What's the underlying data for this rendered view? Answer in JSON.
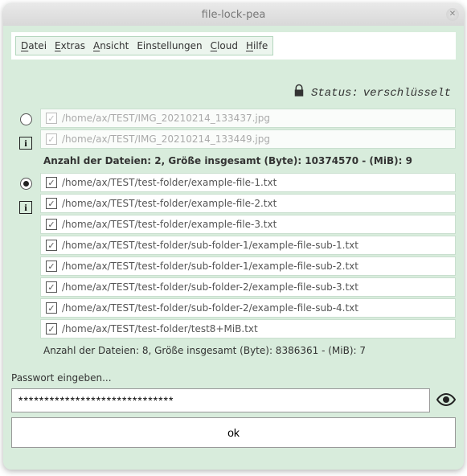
{
  "title": "file-lock-pea",
  "menu": {
    "datei": "Datei",
    "extras": "Extras",
    "ansicht": "Ansicht",
    "einstellungen": "Einstellungen",
    "cloud": "Cloud",
    "hilfe": "Hilfe"
  },
  "status": {
    "label": "Status:",
    "value": "verschlüsselt"
  },
  "groups": [
    {
      "selected": false,
      "dim": true,
      "files": [
        {
          "checked": true,
          "path": "/home/ax/TEST/IMG_20210214_133437.jpg"
        },
        {
          "checked": true,
          "path": "/home/ax/TEST/IMG_20210214_133449.jpg"
        }
      ],
      "summary": "Anzahl der Dateien: 2, Größe insgesamt (Byte): 10374570 - (MiB): 9",
      "summary_bold": true
    },
    {
      "selected": true,
      "dim": false,
      "files": [
        {
          "checked": true,
          "path": "/home/ax/TEST/test-folder/example-file-1.txt"
        },
        {
          "checked": true,
          "path": "/home/ax/TEST/test-folder/example-file-2.txt"
        },
        {
          "checked": true,
          "path": "/home/ax/TEST/test-folder/example-file-3.txt"
        },
        {
          "checked": true,
          "path": "/home/ax/TEST/test-folder/sub-folder-1/example-file-sub-1.txt"
        },
        {
          "checked": true,
          "path": "/home/ax/TEST/test-folder/sub-folder-1/example-file-sub-2.txt"
        },
        {
          "checked": true,
          "path": "/home/ax/TEST/test-folder/sub-folder-2/example-file-sub-3.txt"
        },
        {
          "checked": true,
          "path": "/home/ax/TEST/test-folder/sub-folder-2/example-file-sub-4.txt"
        },
        {
          "checked": true,
          "path": "/home/ax/TEST/test-folder/test8+MiB.txt"
        }
      ],
      "summary": "Anzahl der Dateien: 8, Größe insgesamt (Byte): 8386361 - (MiB): 7",
      "summary_bold": false
    }
  ],
  "password": {
    "label": "Passwort eingeben...",
    "value": "******************************"
  },
  "ok_label": "ok"
}
